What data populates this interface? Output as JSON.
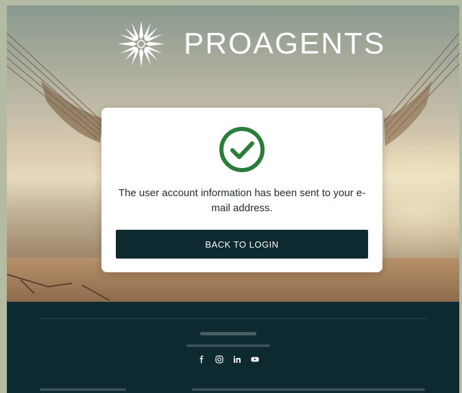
{
  "brand": {
    "name": "PROAGENTS"
  },
  "card": {
    "message": "The user account information has been sent to your e-mail address.",
    "button_label": "BACK TO LOGIN"
  },
  "colors": {
    "success": "#2a7d3a",
    "button_bg": "#0d2a30",
    "footer_bg": "#0d2a30"
  },
  "icons": {
    "logo": "sun-logo-icon",
    "status": "check-circle-icon",
    "social": [
      "facebook-icon",
      "instagram-icon",
      "linkedin-icon",
      "youtube-icon"
    ]
  }
}
